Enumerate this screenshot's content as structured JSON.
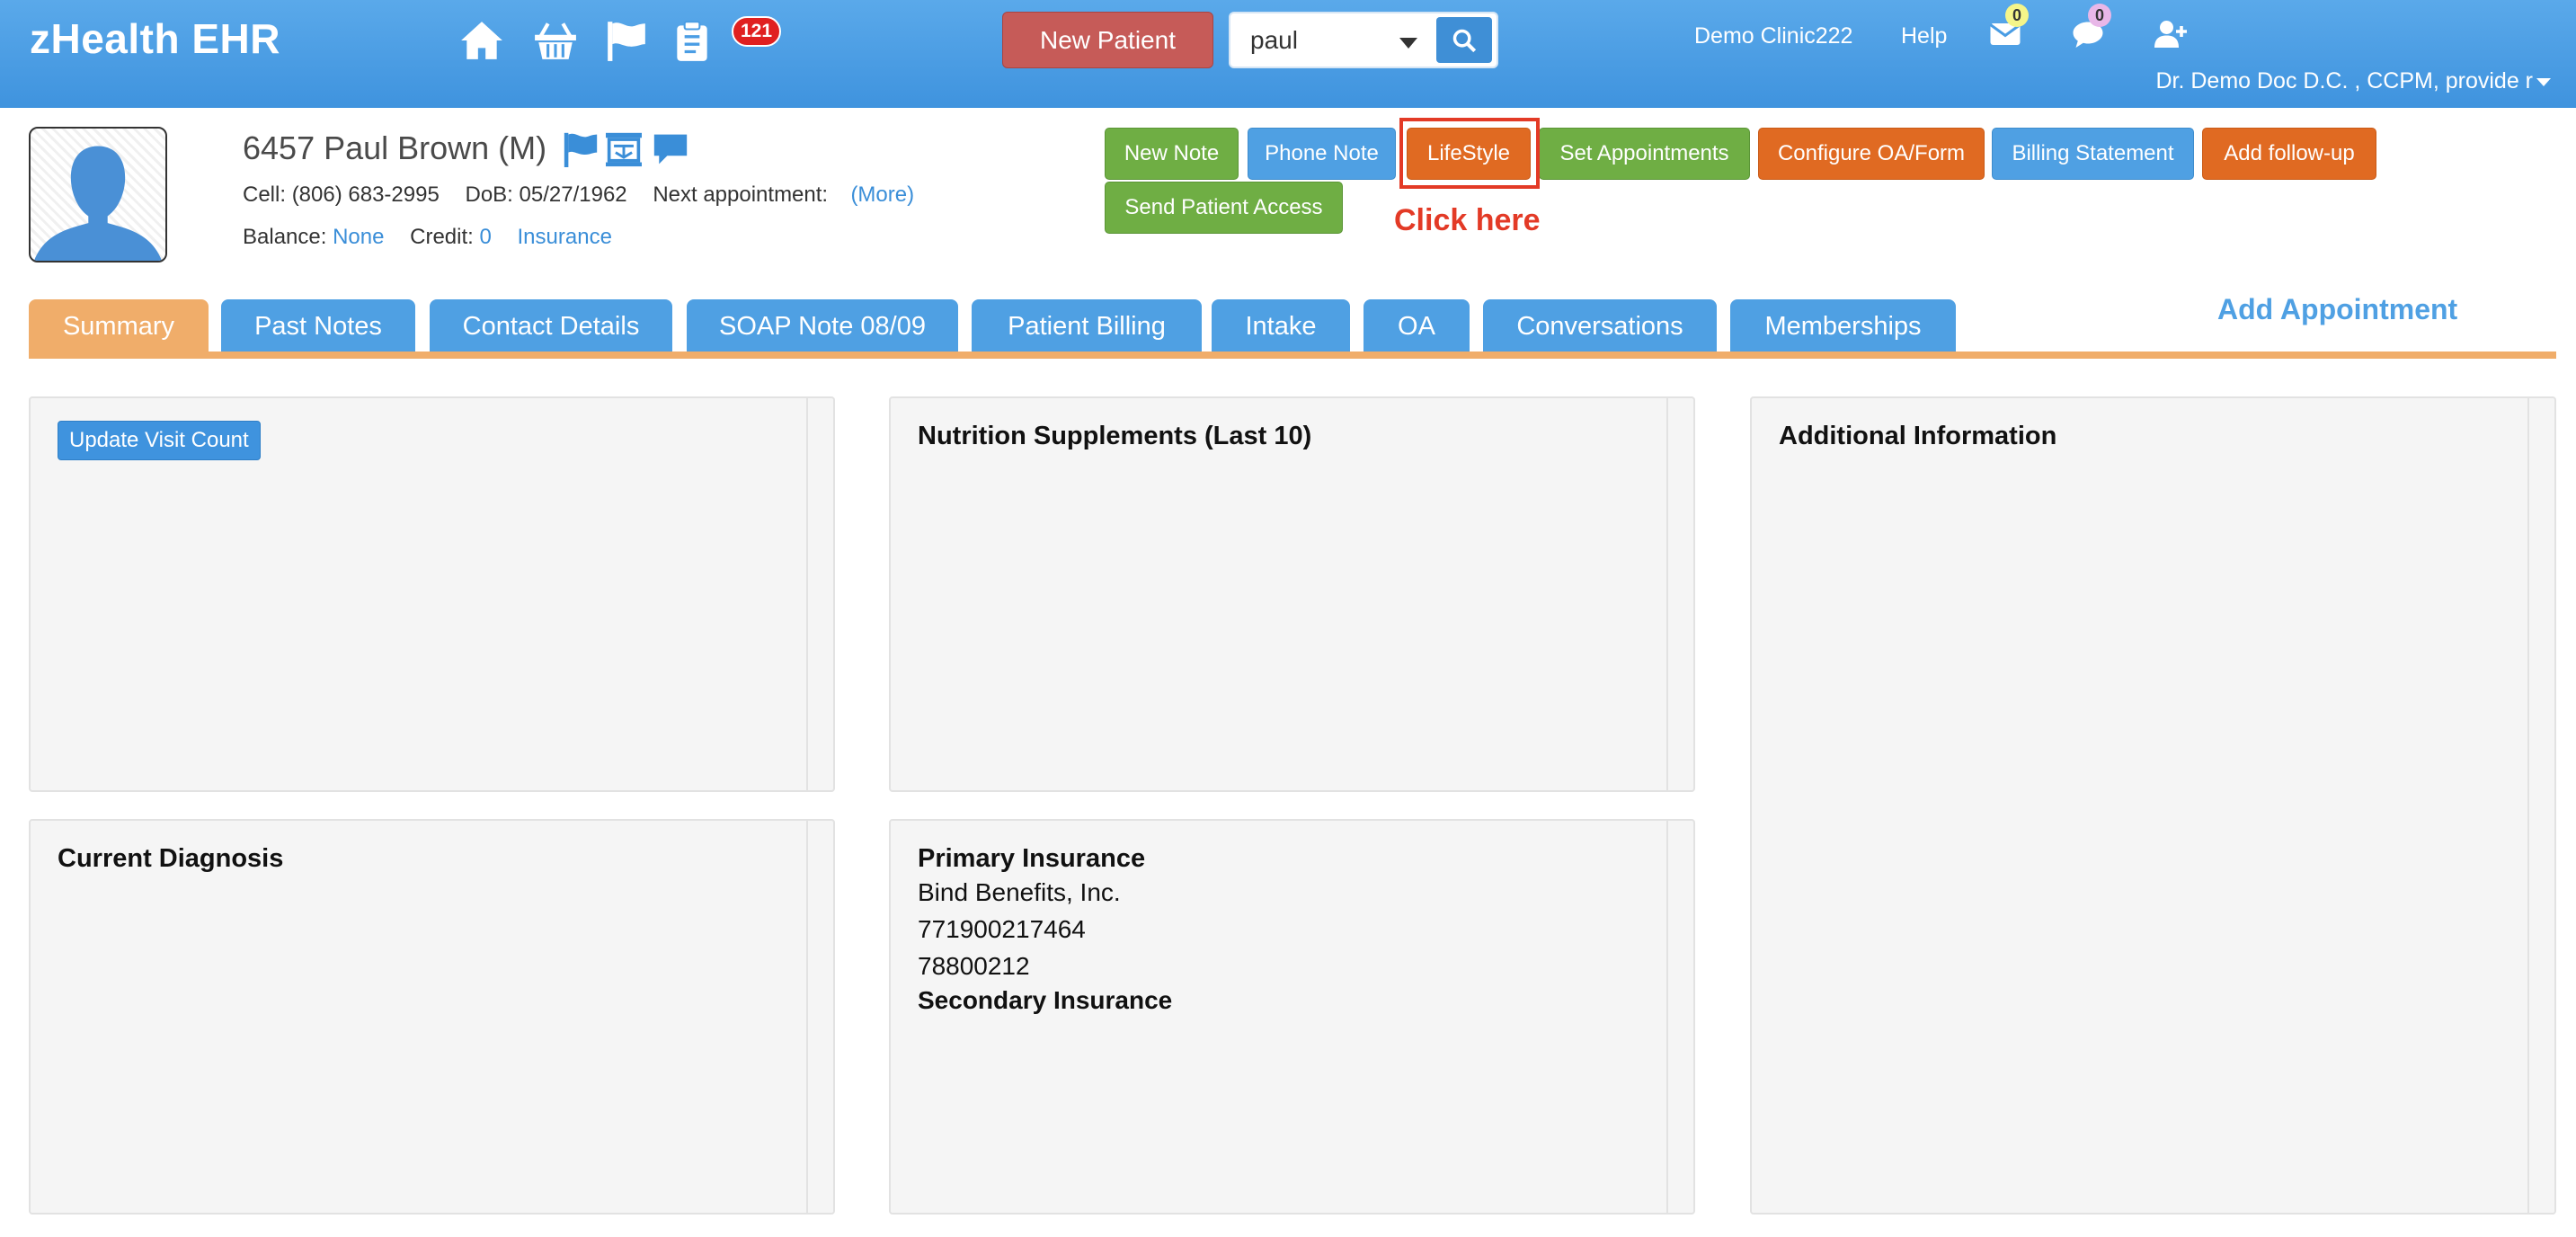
{
  "app": {
    "brand": "zHealth EHR",
    "nav_badge": "121",
    "new_patient_label": "New Patient",
    "search_value": "paul",
    "clinic": "Demo Clinic222",
    "help": "Help",
    "mail_count": "0",
    "chat_count": "0",
    "user": "Dr. Demo Doc D.C. , CCPM, provide r"
  },
  "patient": {
    "name": "6457 Paul Brown (M)",
    "cell_label": "Cell:",
    "cell": "(806) 683-2995",
    "dob_label": "DoB:",
    "dob": "05/27/1962",
    "next_appt_label": "Next appointment:",
    "more_link": "(More)",
    "balance_label": "Balance:",
    "balance": "None",
    "credit_label": "Credit:",
    "credit": "0",
    "insurance_link": "Insurance"
  },
  "actions": {
    "new_note": "New Note",
    "phone_note": "Phone Note",
    "lifestyle": "LifeStyle",
    "set_appointments": "Set Appointments",
    "configure_oa": "Configure OA/Form",
    "billing_statement": "Billing Statement",
    "add_followup": "Add follow-up",
    "send_access": "Send Patient Access",
    "annotation": "Click here"
  },
  "tabs": {
    "items": [
      {
        "label": "Summary",
        "active": true
      },
      {
        "label": "Past Notes"
      },
      {
        "label": "Contact Details"
      },
      {
        "label": "SOAP Note 08/09"
      },
      {
        "label": "Patient Billing"
      },
      {
        "label": "Intake"
      },
      {
        "label": "OA"
      },
      {
        "label": "Conversations"
      },
      {
        "label": "Memberships"
      }
    ],
    "add_appointment": "Add Appointment"
  },
  "panels": {
    "visit": {
      "button": "Update Visit Count"
    },
    "nutrition": {
      "title": "Nutrition Supplements (Last 10)"
    },
    "additional": {
      "title": "Additional Information"
    },
    "diagnosis": {
      "title": "Current Diagnosis"
    },
    "insurance": {
      "primary_title": "Primary Insurance",
      "primary_name": "Bind Benefits, Inc.",
      "primary_id": "771900217464",
      "primary_group": "78800212",
      "secondary_title": "Secondary Insurance"
    }
  },
  "colors": {
    "header": "#4a9de4",
    "tab_active": "#f0ad6a",
    "tab": "#4fa0e3",
    "highlight": "#e33a26"
  }
}
